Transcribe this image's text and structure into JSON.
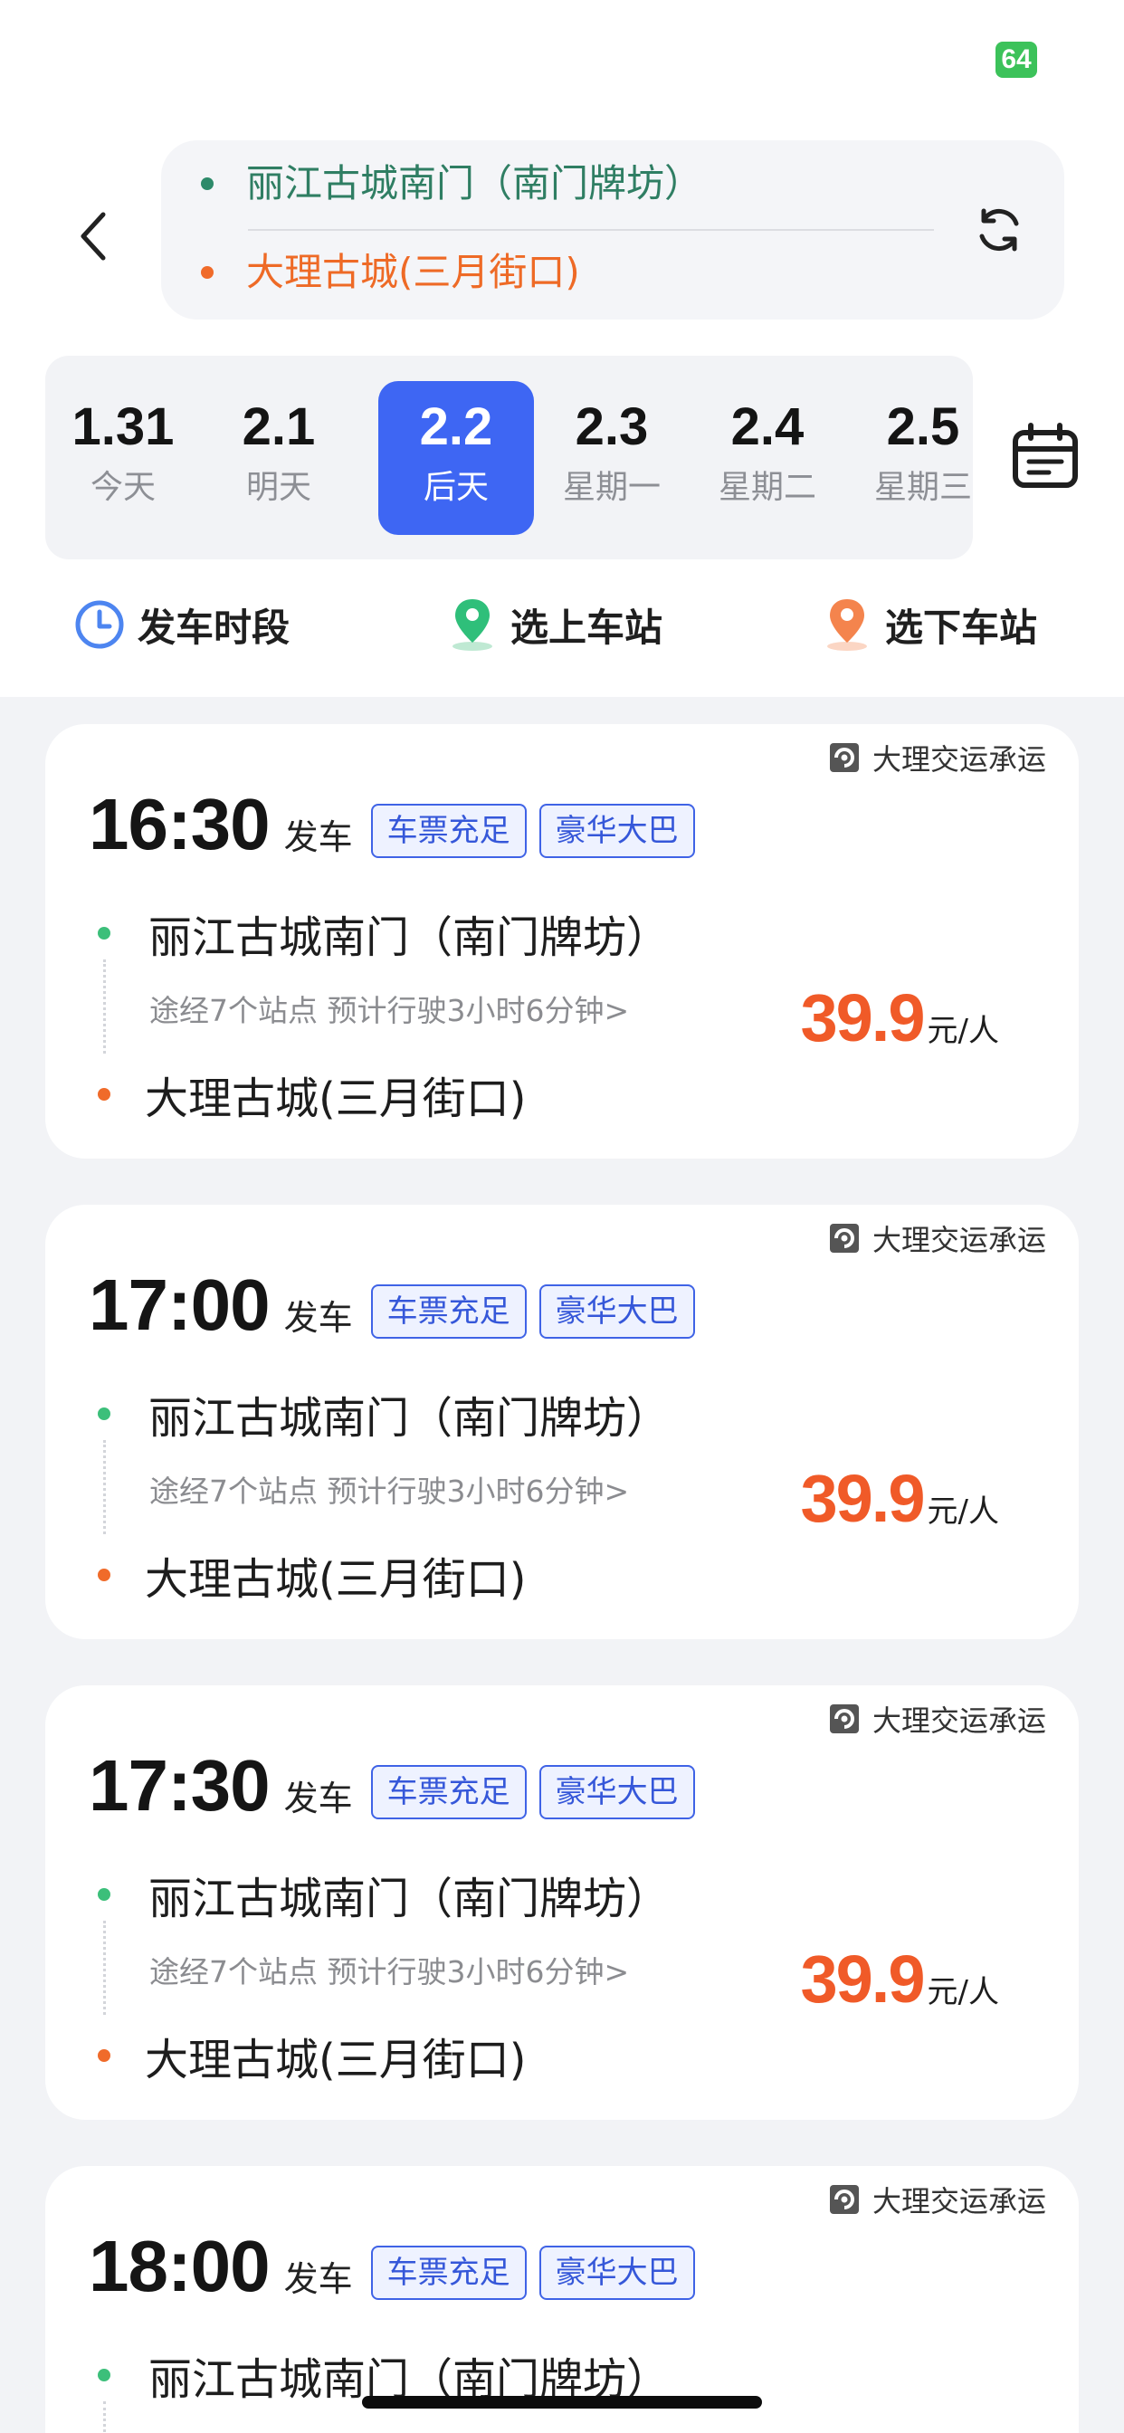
{
  "status_bar": {
    "battery": "64"
  },
  "route": {
    "from": "丽江古城南门（南门牌坊）",
    "to": "大理古城(三月街口)"
  },
  "dates": [
    {
      "date": "1.31",
      "label": "今天",
      "active": false
    },
    {
      "date": "2.1",
      "label": "明天",
      "active": false
    },
    {
      "date": "2.2",
      "label": "后天",
      "active": true
    },
    {
      "date": "2.3",
      "label": "星期一",
      "active": false
    },
    {
      "date": "2.4",
      "label": "星期二",
      "active": false
    },
    {
      "date": "2.5",
      "label": "星期三",
      "active": false
    }
  ],
  "filters": [
    {
      "label": "发车时段",
      "icon": "clock-icon"
    },
    {
      "label": "选上车站",
      "icon": "pickup-pin-icon"
    },
    {
      "label": "选下车站",
      "icon": "dropoff-pin-icon"
    }
  ],
  "trips": [
    {
      "operator": "大理交运承运",
      "time": "16:30",
      "depart_label": "发车",
      "tags": [
        "车票充足",
        "豪华大巴"
      ],
      "from": "丽江古城南门（南门牌坊）",
      "via": "途经7个站点 预计行驶3小时6分钟>",
      "to": "大理古城(三月街口)",
      "price": "39.9",
      "unit": "元/人"
    },
    {
      "operator": "大理交运承运",
      "time": "17:00",
      "depart_label": "发车",
      "tags": [
        "车票充足",
        "豪华大巴"
      ],
      "from": "丽江古城南门（南门牌坊）",
      "via": "途经7个站点 预计行驶3小时6分钟>",
      "to": "大理古城(三月街口)",
      "price": "39.9",
      "unit": "元/人"
    },
    {
      "operator": "大理交运承运",
      "time": "17:30",
      "depart_label": "发车",
      "tags": [
        "车票充足",
        "豪华大巴"
      ],
      "from": "丽江古城南门（南门牌坊）",
      "via": "途经7个站点 预计行驶3小时6分钟>",
      "to": "大理古城(三月街口)",
      "price": "39.9",
      "unit": "元/人"
    },
    {
      "operator": "大理交运承运",
      "time": "18:00",
      "depart_label": "发车",
      "tags": [
        "车票充足",
        "豪华大巴"
      ],
      "from": "丽江古城南门（南门牌坊）"
    }
  ],
  "colors": {
    "accent": "#3e66f3",
    "price": "#f05a28",
    "from_station": "#2f7e63",
    "to_station": "#ee6a26"
  }
}
